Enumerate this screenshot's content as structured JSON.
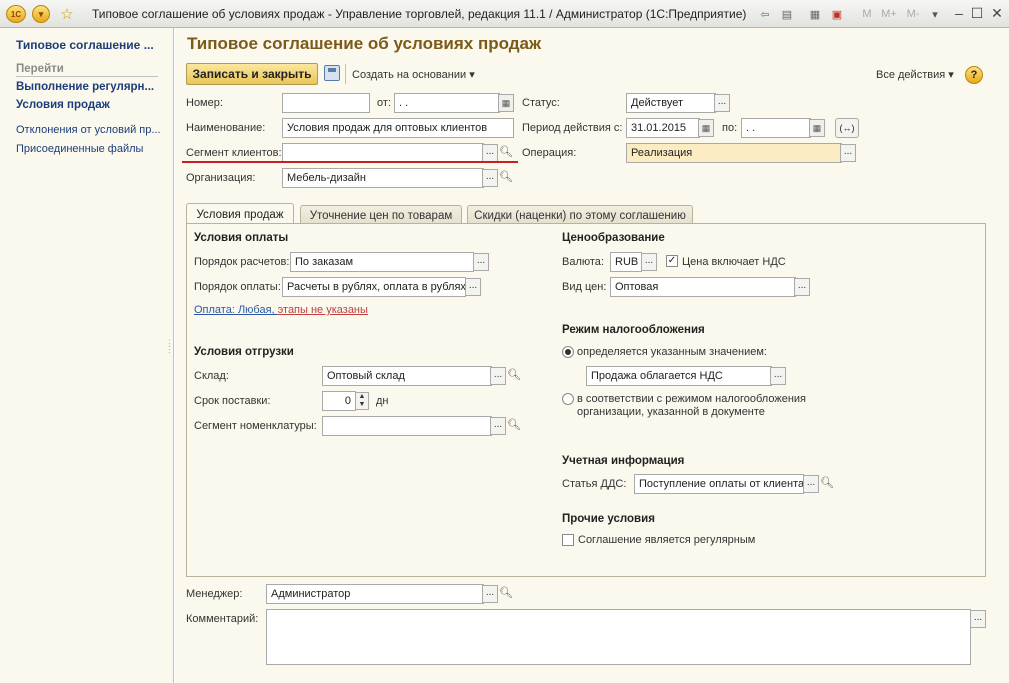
{
  "window": {
    "title": "Типовое соглашение об условиях продаж - Управление торговлей, редакция 11.1 / Администратор  (1С:Предприятие)",
    "app_logo": "1С"
  },
  "sidebar": {
    "title": "Типовое соглашение ...",
    "goto_label": "Перейти",
    "items": [
      {
        "label": "Выполнение регулярн..."
      },
      {
        "label": "Условия продаж"
      }
    ],
    "links": [
      {
        "label": "Отклонения от условий пр..."
      },
      {
        "label": "Присоединенные файлы"
      }
    ]
  },
  "header": {
    "title": "Типовое соглашение об условиях продаж"
  },
  "toolbar": {
    "save_close_label": "Записать и закрыть",
    "create_basis_label": "Создать на основании",
    "all_actions_label": "Все действия",
    "help_label": "?"
  },
  "form": {
    "number_label": "Номер:",
    "number_value": "",
    "from_label": "от:",
    "from_value": " .  .",
    "status_label": "Статус:",
    "status_value": "Действует",
    "name_label": "Наименование:",
    "name_value": "Условия продаж для оптовых клиентов",
    "period_label": "Период действия с:",
    "period_from": "31.01.2015",
    "period_to_label": "по:",
    "period_to": " .  .",
    "segment_label": "Сегмент клиентов:",
    "segment_value": "",
    "operation_label": "Операция:",
    "operation_value": "Реализация",
    "org_label": "Организация:",
    "org_value": "Мебель-дизайн"
  },
  "tabs": [
    {
      "label": "Условия продаж"
    },
    {
      "label": "Уточнение цен по товарам"
    },
    {
      "label": "Скидки (наценки) по этому соглашению"
    }
  ],
  "payment": {
    "section": "Условия оплаты",
    "order_label": "Порядок расчетов:",
    "order_value": "По заказам",
    "method_label": "Порядок оплаты:",
    "method_value": "Расчеты в рублях, оплата в рублях",
    "link_a": "Оплата: Любая, ",
    "link_b": "этапы не указаны"
  },
  "shipping": {
    "section": "Условия отгрузки",
    "warehouse_label": "Склад:",
    "warehouse_value": "Оптовый склад",
    "delivery_label": "Срок поставки:",
    "delivery_value": "0",
    "delivery_unit": "дн",
    "nomenclature_label": "Сегмент номенклатуры:",
    "nomenclature_value": ""
  },
  "pricing": {
    "section": "Ценообразование",
    "currency_label": "Валюта:",
    "currency_value": "RUB",
    "vat_label": "Цена включает НДС",
    "vat_checked": true,
    "price_type_label": "Вид цен:",
    "price_type_value": "Оптовая"
  },
  "tax": {
    "section": "Режим налогообложения",
    "option1": "определяется указанным значением:",
    "option1_value": "Продажа облагается НДС",
    "option2_line1": "в соответствии с режимом налогообложения",
    "option2_line2": "организации, указанной в документе",
    "selected": 1
  },
  "accounting": {
    "section": "Учетная информация",
    "dds_label": "Статья ДДС:",
    "dds_value": "Поступление оплаты от клиента"
  },
  "other": {
    "section": "Прочие условия",
    "regular_label": "Соглашение является регулярным",
    "regular_checked": false
  },
  "footer": {
    "manager_label": "Менеджер:",
    "manager_value": "Администратор",
    "comment_label": "Комментарий:",
    "comment_value": ""
  },
  "colors": {
    "accent_title": "#7c5a18",
    "background": "#fbf9ed",
    "primary_button": "#e9c555",
    "highlight_field": "#fcecc2",
    "annotation_red": "#c82020"
  }
}
